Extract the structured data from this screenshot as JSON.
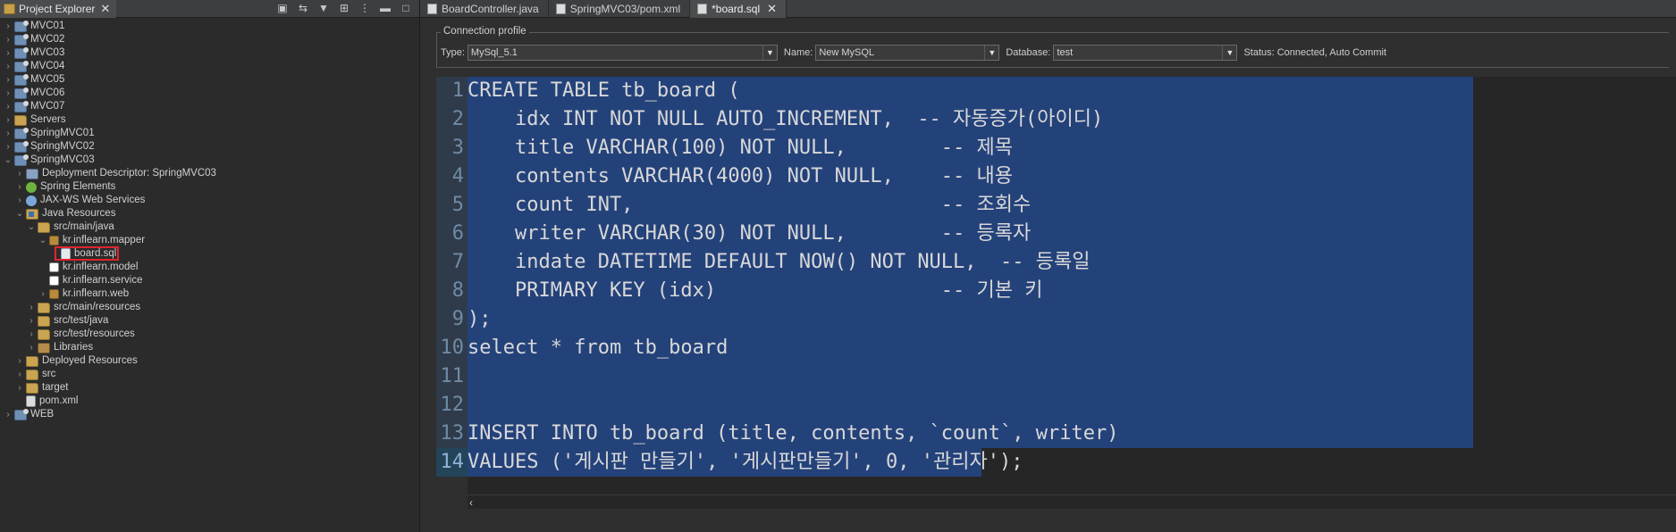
{
  "left_panel": {
    "tab_title": "Project Explorer",
    "toolbar": [
      "collapse-all-icon",
      "link-editor-icon",
      "filter-icon",
      "focus-icon",
      "view-menu-icon",
      "minimize-icon",
      "maximize-icon"
    ],
    "tree": [
      {
        "depth": 0,
        "expand": "collapsed",
        "icon": "project",
        "label": "MVC01"
      },
      {
        "depth": 0,
        "expand": "collapsed",
        "icon": "project",
        "label": "MVC02"
      },
      {
        "depth": 0,
        "expand": "collapsed",
        "icon": "project",
        "label": "MVC03"
      },
      {
        "depth": 0,
        "expand": "collapsed",
        "icon": "project",
        "label": "MVC04"
      },
      {
        "depth": 0,
        "expand": "collapsed",
        "icon": "project",
        "label": "MVC05"
      },
      {
        "depth": 0,
        "expand": "collapsed",
        "icon": "project",
        "label": "MVC06"
      },
      {
        "depth": 0,
        "expand": "collapsed",
        "icon": "project",
        "label": "MVC07"
      },
      {
        "depth": 0,
        "expand": "collapsed",
        "icon": "folder",
        "label": "Servers"
      },
      {
        "depth": 0,
        "expand": "collapsed",
        "icon": "project",
        "label": "SpringMVC01"
      },
      {
        "depth": 0,
        "expand": "collapsed",
        "icon": "project",
        "label": "SpringMVC02"
      },
      {
        "depth": 0,
        "expand": "expanded",
        "icon": "project",
        "label": "SpringMVC03"
      },
      {
        "depth": 1,
        "expand": "collapsed",
        "icon": "dd",
        "label": "Deployment Descriptor: SpringMVC03"
      },
      {
        "depth": 1,
        "expand": "collapsed",
        "icon": "spring",
        "label": "Spring Elements"
      },
      {
        "depth": 1,
        "expand": "collapsed",
        "icon": "ws",
        "label": "JAX-WS Web Services"
      },
      {
        "depth": 1,
        "expand": "expanded",
        "icon": "java",
        "label": "Java Resources"
      },
      {
        "depth": 2,
        "expand": "expanded",
        "icon": "folder",
        "label": "src/main/java"
      },
      {
        "depth": 3,
        "expand": "expanded",
        "icon": "pkg",
        "label": "kr.inflearn.mapper"
      },
      {
        "depth": 4,
        "expand": "none",
        "icon": "sql",
        "label": "board.sql",
        "highlight": true
      },
      {
        "depth": 3,
        "expand": "none",
        "icon": "pkg-empty",
        "label": "kr.inflearn.model"
      },
      {
        "depth": 3,
        "expand": "none",
        "icon": "pkg-empty",
        "label": "kr.inflearn.service"
      },
      {
        "depth": 3,
        "expand": "collapsed",
        "icon": "pkg",
        "label": "kr.inflearn.web"
      },
      {
        "depth": 2,
        "expand": "collapsed",
        "icon": "folder",
        "label": "src/main/resources"
      },
      {
        "depth": 2,
        "expand": "collapsed",
        "icon": "folder",
        "label": "src/test/java"
      },
      {
        "depth": 2,
        "expand": "collapsed",
        "icon": "folder",
        "label": "src/test/resources"
      },
      {
        "depth": 2,
        "expand": "collapsed",
        "icon": "lib",
        "label": "Libraries"
      },
      {
        "depth": 1,
        "expand": "collapsed",
        "icon": "folder",
        "label": "Deployed Resources"
      },
      {
        "depth": 1,
        "expand": "collapsed",
        "icon": "folder",
        "label": "src"
      },
      {
        "depth": 1,
        "expand": "collapsed",
        "icon": "folder",
        "label": "target"
      },
      {
        "depth": 1,
        "expand": "none",
        "icon": "xml",
        "label": "pom.xml"
      },
      {
        "depth": 0,
        "expand": "collapsed",
        "icon": "project",
        "label": "WEB"
      }
    ]
  },
  "editor_tabs": [
    {
      "label": "BoardController.java",
      "active": false
    },
    {
      "label": "SpringMVC03/pom.xml",
      "active": false
    },
    {
      "label": "*board.sql",
      "active": true
    }
  ],
  "connection": {
    "legend": "Connection profile",
    "type_label": "Type:",
    "type_value": "MySql_5.1",
    "name_label": "Name:",
    "name_value": "New MySQL",
    "db_label": "Database:",
    "db_value": "test",
    "status_label": "Status:",
    "status_value": "Connected, Auto Commit"
  },
  "code_lines": [
    {
      "n": "1",
      "t": "CREATE TABLE tb_board (",
      "sel": true
    },
    {
      "n": "2",
      "t": "    idx INT NOT NULL AUTO_INCREMENT,  -- 자동증가(아이디)",
      "sel": true
    },
    {
      "n": "3",
      "t": "    title VARCHAR(100) NOT NULL,        -- 제목",
      "sel": true
    },
    {
      "n": "4",
      "t": "    contents VARCHAR(4000) NOT NULL,    -- 내용",
      "sel": true
    },
    {
      "n": "5",
      "t": "    count INT,                          -- 조회수",
      "sel": true
    },
    {
      "n": "6",
      "t": "    writer VARCHAR(30) NOT NULL,        -- 등록자",
      "sel": true
    },
    {
      "n": "7",
      "t": "    indate DATETIME DEFAULT NOW() NOT NULL,  -- 등록일",
      "sel": true
    },
    {
      "n": "8",
      "t": "    PRIMARY KEY (idx)                   -- 기본 키",
      "sel": true
    },
    {
      "n": "9",
      "t": ");",
      "sel": true
    },
    {
      "n": "10",
      "t": "select * from tb_board",
      "sel": true
    },
    {
      "n": "11",
      "t": "",
      "sel": true
    },
    {
      "n": "12",
      "t": "",
      "sel": true
    },
    {
      "n": "13",
      "t": "INSERT INTO tb_board (title, contents, `count`, writer)",
      "sel": true
    },
    {
      "n": "14",
      "t": "VALUES ('게시판 만들기', '게시판만들기', 0, '관리자');",
      "sel": true,
      "current": true
    }
  ]
}
